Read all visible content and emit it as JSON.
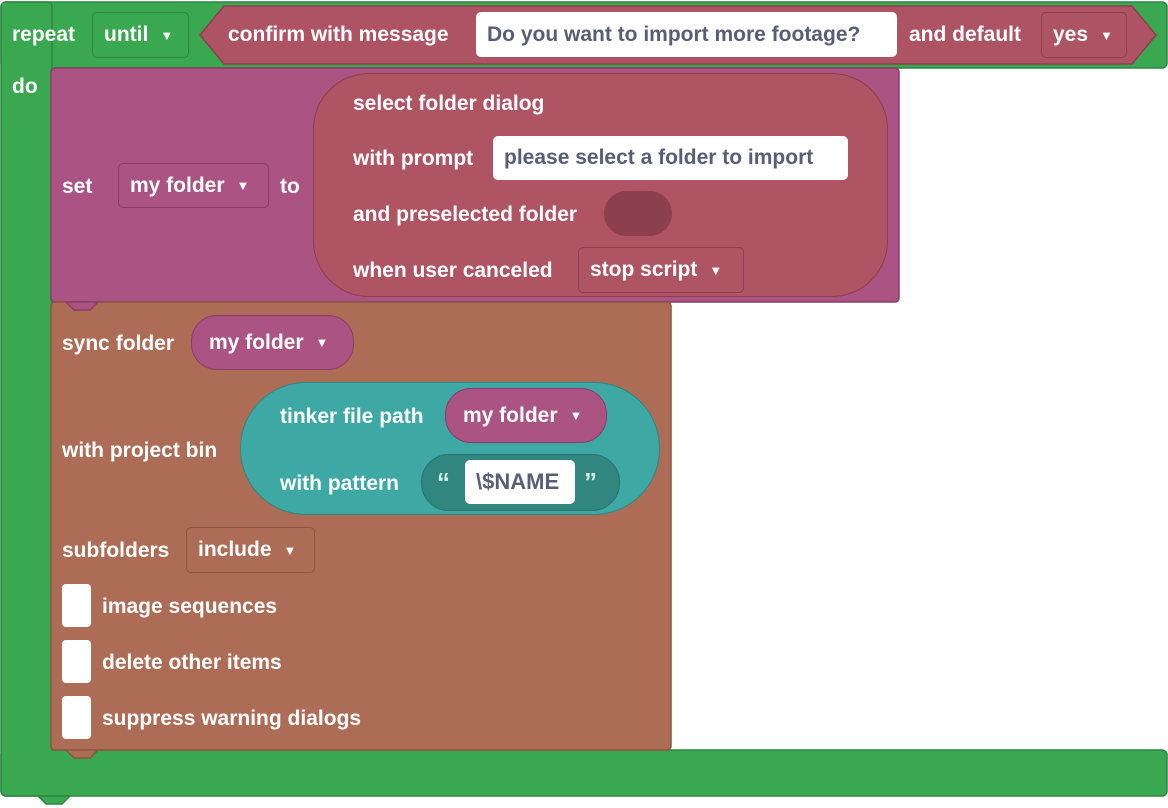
{
  "repeat": {
    "label": "repeat",
    "mode": "until",
    "do_label": "do"
  },
  "confirm": {
    "label": "confirm with message",
    "message": "Do you want to import more footage?",
    "default_label": "and default",
    "default_value": "yes"
  },
  "set_block": {
    "label": "set",
    "variable": "my folder",
    "to_label": "to"
  },
  "folder_dialog": {
    "title": "select folder dialog",
    "prompt_label": "with prompt",
    "prompt_value": "please select a folder to import",
    "preselected_label": "and preselected folder",
    "canceled_label": "when user canceled",
    "canceled_value": "stop script"
  },
  "sync": {
    "label": "sync folder",
    "folder": "my folder",
    "bin_label": "with project bin",
    "subfolders_label": "subfolders",
    "subfolders_value": "include",
    "options": [
      {
        "label": "image sequences"
      },
      {
        "label": "delete other items"
      },
      {
        "label": "suppress warning dialogs"
      }
    ]
  },
  "tinker": {
    "label": "tinker file path",
    "variable": "my folder",
    "pattern_label": "with pattern",
    "open_quote": "“",
    "pattern_value": "\\$NAME",
    "close_quote": "”"
  },
  "colors": {
    "loop_green": "#3aa751",
    "logic_red": "#ae5364",
    "variable_magenta": "#ab5383",
    "dialog_red": "#ae5463",
    "sync_brown": "#ad6c56",
    "text_teal": "#3ea8a5",
    "text_dark_teal": "#318680"
  },
  "icons": {
    "dropdown": "triangle-down",
    "quote_open": "left-double-quote",
    "quote_close": "right-double-quote"
  }
}
